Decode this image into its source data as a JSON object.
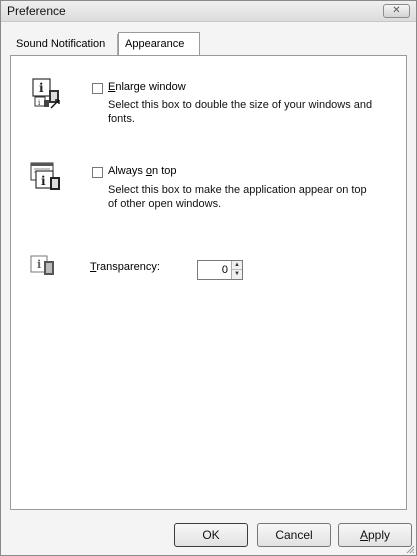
{
  "window": {
    "title": "Preference",
    "close_icon": "close-icon"
  },
  "tabs": [
    {
      "label": "Sound Notification",
      "selected": false
    },
    {
      "label": "Appearance",
      "selected": true
    }
  ],
  "options": {
    "enlarge": {
      "label_pre": "",
      "label_mnemonic": "E",
      "label_post": "nlarge window",
      "checked": false,
      "description": "Select this box to double the size of your windows and fonts.",
      "icon": "enlarge-window-icon"
    },
    "always_on_top": {
      "label_pre": "Always ",
      "label_mnemonic": "o",
      "label_post": "n top",
      "checked": false,
      "description": "Select this box to make the application appear on top of other open windows.",
      "icon": "always-on-top-icon"
    },
    "transparency": {
      "label_pre": "",
      "label_mnemonic": "T",
      "label_post": "ransparency:",
      "value": "0",
      "icon": "transparency-icon"
    }
  },
  "buttons": {
    "ok": "OK",
    "cancel": "Cancel",
    "apply_mnemonic": "A",
    "apply_post": "pply"
  }
}
